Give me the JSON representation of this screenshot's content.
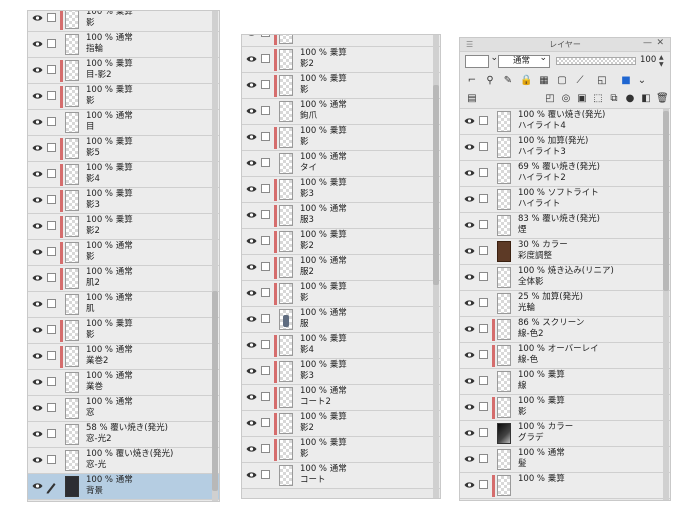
{
  "panel1": {
    "rows": [
      {
        "l1": "100 % 乗算",
        "l2": "影",
        "mark": "red"
      },
      {
        "l1": "100 % 通常",
        "l2": "指輪",
        "mark": "none"
      },
      {
        "l1": "100 % 乗算",
        "l2": "目-影2",
        "mark": "red"
      },
      {
        "l1": "100 % 乗算",
        "l2": "影",
        "mark": "red"
      },
      {
        "l1": "100 % 通常",
        "l2": "目",
        "mark": "none"
      },
      {
        "l1": "100 % 乗算",
        "l2": "影5",
        "mark": "red"
      },
      {
        "l1": "100 % 乗算",
        "l2": "影4",
        "mark": "red"
      },
      {
        "l1": "100 % 乗算",
        "l2": "影3",
        "mark": "red"
      },
      {
        "l1": "100 % 乗算",
        "l2": "影2",
        "mark": "red"
      },
      {
        "l1": "100 % 通常",
        "l2": "影",
        "mark": "red"
      },
      {
        "l1": "100 % 通常",
        "l2": "肌2",
        "mark": "red"
      },
      {
        "l1": "100 % 通常",
        "l2": "肌",
        "mark": "none"
      },
      {
        "l1": "100 % 乗算",
        "l2": "影",
        "mark": "red"
      },
      {
        "l1": "100 % 通常",
        "l2": "業巻2",
        "mark": "red"
      },
      {
        "l1": "100 % 通常",
        "l2": "業巻",
        "mark": "none"
      },
      {
        "l1": "100 % 通常",
        "l2": "窓",
        "mark": "none"
      },
      {
        "l1": "58 % 覆い焼き(発光)",
        "l2": "窓-光2",
        "mark": "none"
      },
      {
        "l1": "100 % 覆い焼き(発光)",
        "l2": "窓-光",
        "mark": "none"
      },
      {
        "l1": "100 % 通常",
        "l2": "背景",
        "mark": "none",
        "thumb": "dark",
        "selected": true
      }
    ]
  },
  "panel2": {
    "rows": [
      {
        "l1": "",
        "l2": "",
        "mark": "red"
      },
      {
        "l1": "100 % 乗算",
        "l2": "影2",
        "mark": "red"
      },
      {
        "l1": "100 % 乗算",
        "l2": "影",
        "mark": "red"
      },
      {
        "l1": "100 % 通常",
        "l2": "鉤爪",
        "mark": "none"
      },
      {
        "l1": "100 % 乗算",
        "l2": "影",
        "mark": "red"
      },
      {
        "l1": "100 % 通常",
        "l2": "タイ",
        "mark": "none"
      },
      {
        "l1": "100 % 乗算",
        "l2": "影3",
        "mark": "red"
      },
      {
        "l1": "100 % 通常",
        "l2": "服3",
        "mark": "red"
      },
      {
        "l1": "100 % 乗算",
        "l2": "影2",
        "mark": "red"
      },
      {
        "l1": "100 % 通常",
        "l2": "服2",
        "mark": "red"
      },
      {
        "l1": "100 % 乗算",
        "l2": "影",
        "mark": "red"
      },
      {
        "l1": "100 % 通常",
        "l2": "服",
        "mark": "none",
        "thumb": "fig"
      },
      {
        "l1": "100 % 乗算",
        "l2": "影4",
        "mark": "red"
      },
      {
        "l1": "100 % 乗算",
        "l2": "影3",
        "mark": "red"
      },
      {
        "l1": "100 % 通常",
        "l2": "コート2",
        "mark": "red"
      },
      {
        "l1": "100 % 乗算",
        "l2": "影2",
        "mark": "red"
      },
      {
        "l1": "100 % 乗算",
        "l2": "影",
        "mark": "red"
      },
      {
        "l1": "100 % 通常",
        "l2": "コート",
        "mark": "none"
      }
    ]
  },
  "panel3": {
    "title": "レイヤー",
    "blend_mode": "通常",
    "opacity": "100",
    "rows": [
      {
        "l1": "100 % 覆い焼き(発光)",
        "l2": "ハイライト4",
        "mark": "none"
      },
      {
        "l1": "100 % 加算(発光)",
        "l2": "ハイライト3",
        "mark": "none"
      },
      {
        "l1": "69 % 覆い焼き(発光)",
        "l2": "ハイライト2",
        "mark": "none"
      },
      {
        "l1": "100 % ソフトライト",
        "l2": "ハイライト",
        "mark": "none"
      },
      {
        "l1": "83 % 覆い焼き(発光)",
        "l2": "煙",
        "mark": "none"
      },
      {
        "l1": "30 % カラー",
        "l2": "彩度調整",
        "mark": "none",
        "thumb": "brown"
      },
      {
        "l1": "100 % 焼き込み(リニア)",
        "l2": "全体影",
        "mark": "none"
      },
      {
        "l1": "25 % 加算(発光)",
        "l2": "光輪",
        "mark": "none"
      },
      {
        "l1": "86 % スクリーン",
        "l2": "線-色2",
        "mark": "red"
      },
      {
        "l1": "100 % オーバーレイ",
        "l2": "線-色",
        "mark": "red"
      },
      {
        "l1": "100 % 乗算",
        "l2": "線",
        "mark": "none"
      },
      {
        "l1": "100 % 乗算",
        "l2": "影",
        "mark": "red"
      },
      {
        "l1": "100 % カラー",
        "l2": "グラデ",
        "mark": "none",
        "thumb": "grad"
      },
      {
        "l1": "100 % 通常",
        "l2": "髪",
        "mark": "none"
      },
      {
        "l1": "100 % 乗算",
        "l2": "",
        "mark": "red"
      }
    ]
  }
}
